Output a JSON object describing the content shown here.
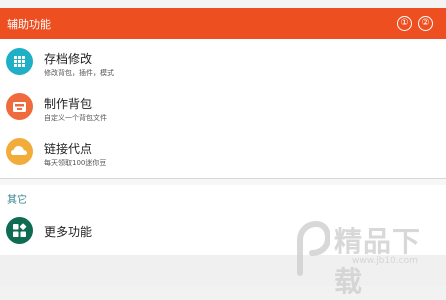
{
  "appbar": {
    "title": "辅助功能",
    "action1": "①",
    "action2": "②",
    "color": "#ee4f20"
  },
  "items": [
    {
      "title": "存档修改",
      "subtitle": "修改背包，插件，模式",
      "icon": "grid-icon",
      "color": "#1fb0c7"
    },
    {
      "title": "制作背包",
      "subtitle": "自定义一个背包文件",
      "icon": "backpack-icon",
      "color": "#ef6a3c"
    },
    {
      "title": "链接代点",
      "subtitle": "每天领取100迷你豆",
      "icon": "cloud-icon",
      "color": "#f2ac3a"
    }
  ],
  "section": {
    "header": "其它",
    "items": [
      {
        "title": "更多功能",
        "icon": "apps-icon",
        "color": "#0f6b52"
      }
    ]
  },
  "watermark": {
    "text": "精品下载",
    "url": "www.jb10.com"
  }
}
